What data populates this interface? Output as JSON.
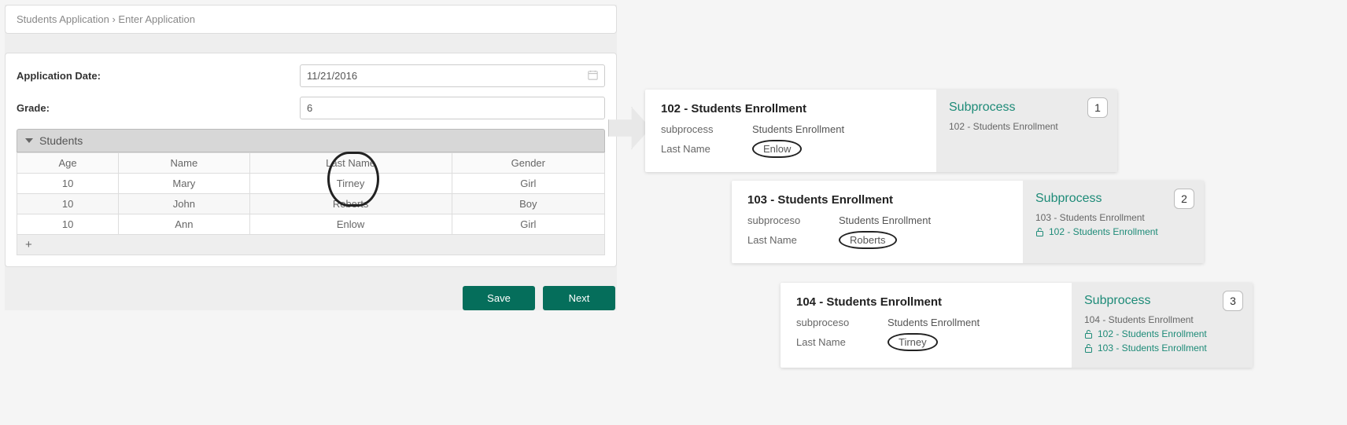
{
  "breadcrumb": {
    "root": "Students Application",
    "sep": "›",
    "leaf": "Enter Application"
  },
  "form": {
    "appDateLabel": "Application Date:",
    "appDateValue": "11/21/2016",
    "gradeLabel": "Grade:",
    "gradeValue": "6",
    "studentsSection": "Students",
    "columns": {
      "age": "Age",
      "name": "Name",
      "lastName": "Last Name",
      "gender": "Gender"
    },
    "rows": [
      {
        "age": "10",
        "name": "Mary",
        "lastName": "Tirney",
        "gender": "Girl"
      },
      {
        "age": "10",
        "name": "John",
        "lastName": "Roberts",
        "gender": "Boy"
      },
      {
        "age": "10",
        "name": "Ann",
        "lastName": "Enlow",
        "gender": "Girl"
      }
    ],
    "addRowLabel": "+",
    "saveLabel": "Save",
    "nextLabel": "Next"
  },
  "cards": [
    {
      "title": "102 - Students Enrollment",
      "rows": [
        {
          "k": "subprocess",
          "v": "Students Enrollment"
        },
        {
          "k": "Last Name",
          "v": "Enlow",
          "circled": true
        }
      ],
      "badge": "1",
      "subLabel": "Subprocess",
      "links": [
        {
          "text": "102 - Students Enrollment",
          "locked": false,
          "teal": false
        }
      ]
    },
    {
      "title": "103 - Students Enrollment",
      "rows": [
        {
          "k": "subproceso",
          "v": "Students Enrollment"
        },
        {
          "k": "Last Name",
          "v": "Roberts",
          "circled": true
        }
      ],
      "badge": "2",
      "subLabel": "Subprocess",
      "links": [
        {
          "text": "103 - Students Enrollment",
          "locked": false,
          "teal": false
        },
        {
          "text": "102 - Students Enrollment",
          "locked": true,
          "teal": true
        }
      ]
    },
    {
      "title": "104 - Students Enrollment",
      "rows": [
        {
          "k": "subproceso",
          "v": "Students Enrollment"
        },
        {
          "k": "Last Name",
          "v": "Tirney",
          "circled": true
        }
      ],
      "badge": "3",
      "subLabel": "Subprocess",
      "links": [
        {
          "text": "104 - Students Enrollment",
          "locked": false,
          "teal": false
        },
        {
          "text": "102 - Students Enrollment",
          "locked": true,
          "teal": true
        },
        {
          "text": "103 - Students Enrollment",
          "locked": true,
          "teal": true
        }
      ]
    }
  ]
}
